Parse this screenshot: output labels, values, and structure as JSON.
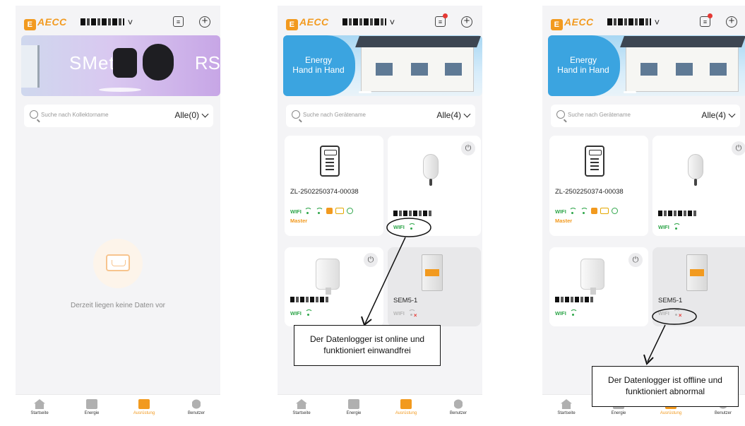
{
  "brand": "AECC",
  "brand_mark": "E",
  "tabs": [
    {
      "label": "Startseite",
      "icon": "home-icon"
    },
    {
      "label": "Energie",
      "icon": "energy-chart-icon"
    },
    {
      "label": "Ausrüstung",
      "icon": "equipment-icon"
    },
    {
      "label": "Benutzer",
      "icon": "user-icon"
    }
  ],
  "screen1": {
    "banner_text": "SMete",
    "banner_text_tail": "RS",
    "search_placeholder": "Suche nach Kollektorname",
    "filter": "Alle(0)",
    "empty_text": "Derzeit liegen keine Daten vor"
  },
  "screen2": {
    "banner_text": "Energy\nHand in Hand",
    "search_placeholder": "Suche nach Gerätename",
    "filter": "Alle(4)",
    "devices": [
      {
        "name": "ZL-2502250374-00038",
        "status": "WIFI",
        "status_color": "#2fa64a",
        "badge": "Master",
        "icon": "inverter-icon"
      },
      {
        "name": "",
        "status": "WIFI",
        "status_color": "#2fa64a",
        "icon": "ev-charger-icon"
      },
      {
        "name": "",
        "status": "WIFI",
        "status_color": "#2fa64a",
        "icon": "smart-plug-icon"
      },
      {
        "name": "SEM5-1",
        "status": "WIFI",
        "status_color": "#b7b7b7",
        "offline": true,
        "icon": "smart-meter-icon"
      }
    ],
    "callout": "Der Datenlogger ist online und funktioniert einwandfrei"
  },
  "screen3": {
    "banner_text": "Energy\nHand in Hand",
    "search_placeholder": "Suche nach Gerätename",
    "filter": "Alle(4)",
    "devices": [
      {
        "name": "ZL-2502250374-00038",
        "status": "WIFI",
        "status_color": "#2fa64a",
        "badge": "Master",
        "icon": "inverter-icon"
      },
      {
        "name": "",
        "status": "WIFI",
        "status_color": "#2fa64a",
        "icon": "ev-charger-icon"
      },
      {
        "name": "",
        "status": "WIFI",
        "status_color": "#2fa64a",
        "icon": "smart-plug-icon"
      },
      {
        "name": "SEM5-1",
        "status": "WIFI",
        "status_color": "#b7b7b7",
        "offline": true,
        "icon": "smart-meter-icon"
      }
    ],
    "callout": "Der Datenlogger ist offline und funktioniert abnormal"
  },
  "colors": {
    "accent": "#f29a1f",
    "online": "#2fa64a",
    "offline_x": "#e53935"
  }
}
